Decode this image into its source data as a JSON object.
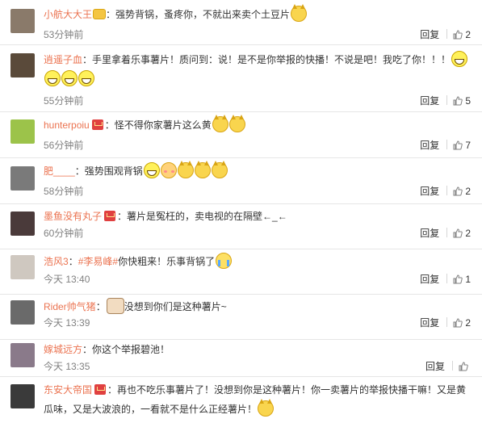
{
  "labels": {
    "reply": "回复"
  },
  "comments": [
    {
      "user": "小航大大王",
      "vip": false,
      "crown": true,
      "text": "：强势背锅，蚤疼你，不就出来卖个土豆片",
      "emojis": [
        "cat"
      ],
      "time": "53分钟前",
      "likes": "2",
      "avatar_color": "#8a7a6a"
    },
    {
      "user": "逍遥子血",
      "vip": false,
      "crown": false,
      "text": "：手里拿着乐事薯片！质问到：说！是不是你举报的快播！不说是吧！我吃了你！！！",
      "emojis": [
        "grin",
        "grin",
        "grin",
        "grin"
      ],
      "time": "55分钟前",
      "likes": "5",
      "avatar_color": "#5a4a3a"
    },
    {
      "user": "hunterpoiu",
      "vip": true,
      "crown": false,
      "text": "：怪不得你家薯片这么黄",
      "emojis": [
        "cat",
        "cat"
      ],
      "time": "56分钟前",
      "likes": "7",
      "avatar_color": "#9cc34a"
    },
    {
      "user": "肥____",
      "vip": false,
      "crown": false,
      "text": "：强势围观背锅",
      "emojis": [
        "grin",
        "shy",
        "cat",
        "cat",
        "cat"
      ],
      "time": "58分钟前",
      "likes": "2",
      "avatar_color": "#7a7a7a"
    },
    {
      "user": "墨鱼没有丸子",
      "vip": true,
      "crown": false,
      "text": "：薯片是冤枉的，卖电视的在隔壁←_←",
      "emojis": [],
      "time": "60分钟前",
      "likes": "2",
      "avatar_color": "#4a3a3a"
    },
    {
      "user": "浩风3",
      "vip": false,
      "crown": false,
      "topic": "#李易峰#",
      "text": "你快粗来！乐事背锅了",
      "emojis": [
        "cry"
      ],
      "time": "今天 13:40",
      "likes": "1",
      "avatar_color": "#cfc8c0"
    },
    {
      "user": "Rider帅气猪",
      "vip": false,
      "crown": false,
      "dog_before": true,
      "text": "没想到你们是这种薯片~",
      "emojis": [],
      "time": "今天 13:39",
      "likes": "2",
      "avatar_color": "#6a6a6a"
    },
    {
      "user": "嫁城远方",
      "vip": false,
      "crown": false,
      "text": "：你这个举报碧池！",
      "emojis": [],
      "time": "今天 13:35",
      "likes": "",
      "avatar_color": "#8a7a8a"
    },
    {
      "user": "东安大帝国",
      "vip": true,
      "crown": false,
      "text": "：再也不吃乐事薯片了！没想到你是这种薯片！你一卖薯片的举报快播干嘛！又是黄瓜味，又是大波浪的，一看就不是什么正经薯片！",
      "emojis": [
        "cat"
      ],
      "time": "",
      "likes": "",
      "avatar_color": "#3a3a3a"
    }
  ]
}
